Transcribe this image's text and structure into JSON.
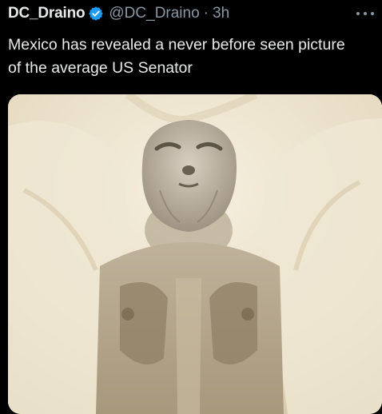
{
  "tweet": {
    "display_name": "DC_Draino",
    "handle": "@DC_Draino",
    "separator": "·",
    "time": "3h",
    "text": "Mexico has revealed a never before seen picture of the average US Senator",
    "icons": {
      "verified": "verified-badge-icon",
      "more": "more-options-icon"
    },
    "colors": {
      "verified_badge": "#1d9bf0",
      "secondary_text": "#8b98a5",
      "primary_text": "#e7e9ea",
      "background": "#000000"
    }
  }
}
